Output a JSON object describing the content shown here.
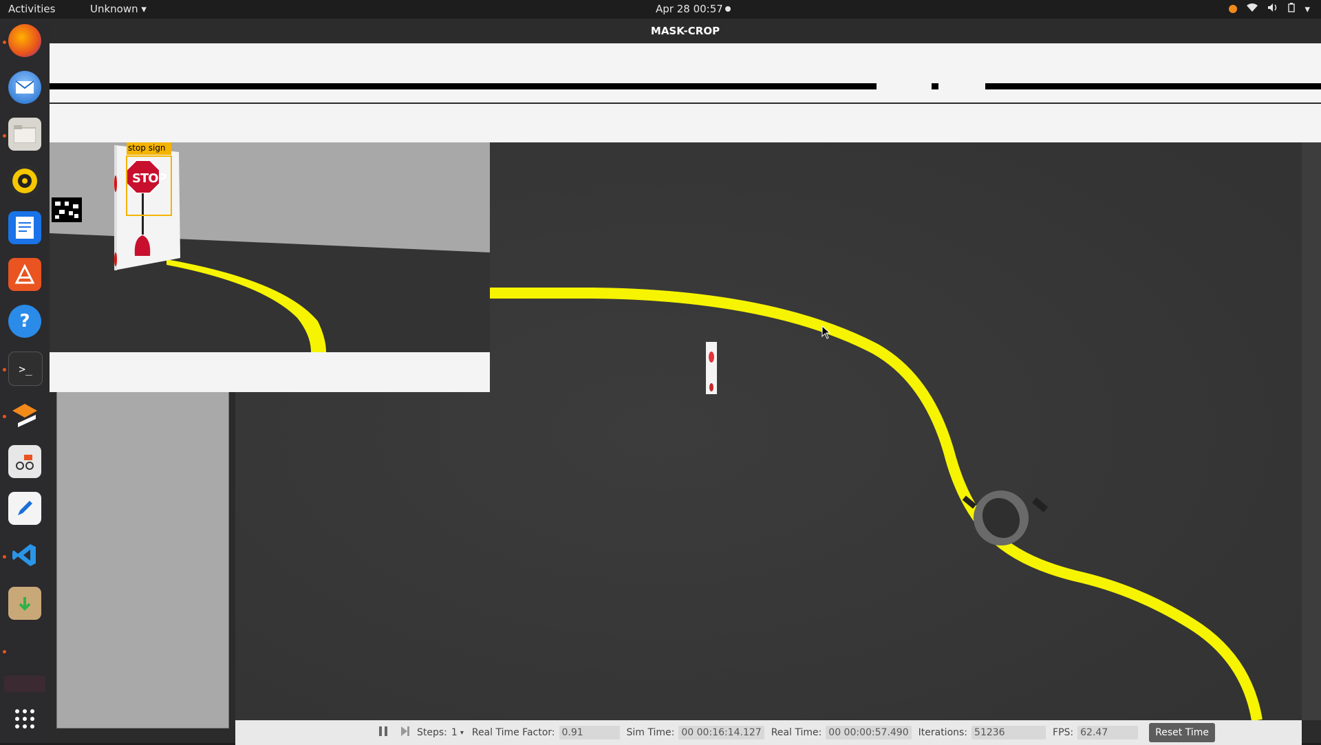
{
  "topbar": {
    "activities": "Activities",
    "app_menu": "Unknown",
    "clock": "Apr 28  00:57"
  },
  "window": {
    "title": "MASK-CROP"
  },
  "overlay": {
    "detection_label": "stop sign",
    "sign_text": "STOP"
  },
  "toolbar": {
    "steps_label": "Steps:",
    "steps_value": "1",
    "rtf_label": "Real Time Factor:",
    "rtf_value": "0.91",
    "sim_time_label": "Sim Time:",
    "sim_time_value": "00 00:16:14.127",
    "real_time_label": "Real Time:",
    "real_time_value": "00 00:00:57.490",
    "iterations_label": "Iterations:",
    "iterations_value": "51236",
    "fps_label": "FPS:",
    "fps_value": "62.47",
    "reset_label": "Reset Time"
  },
  "dock": {
    "icons": [
      "firefox-icon",
      "thunderbird-icon",
      "files-icon",
      "rhythmbox-icon",
      "writer-icon",
      "app-center-icon",
      "help-icon",
      "terminal-icon",
      "ros-icon",
      "reader-icon",
      "editor-icon",
      "vscode-icon",
      "installer-icon",
      "show-apps-icon"
    ]
  },
  "colors": {
    "lane": "#f6f400",
    "ground": "#3a3a3a",
    "accent": "#e95420"
  }
}
